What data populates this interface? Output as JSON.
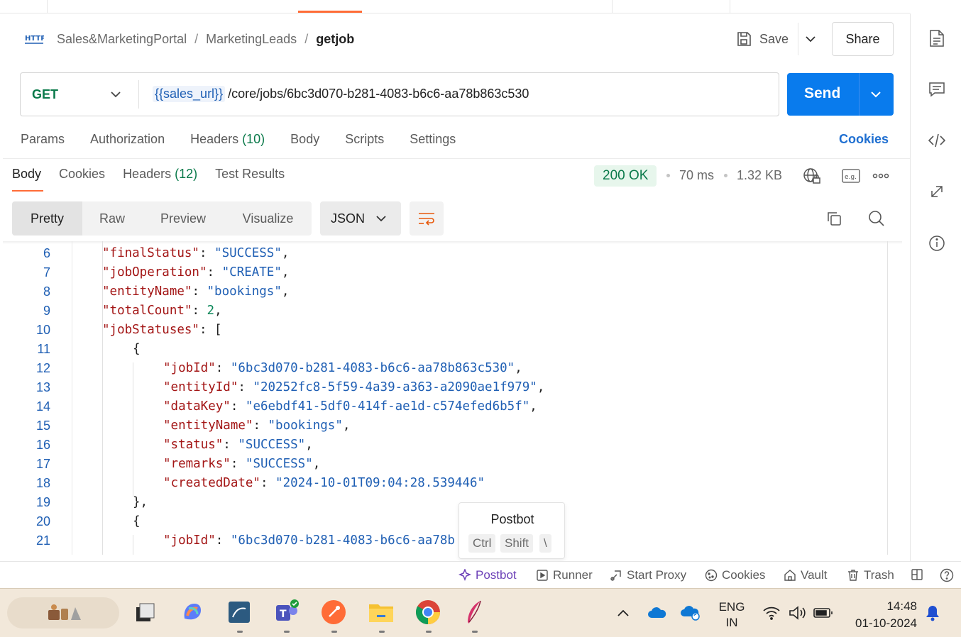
{
  "breadcrumb": {
    "items": [
      "Sales&MarketingPortal",
      "MarketingLeads"
    ],
    "separator": "/",
    "current": "getjob"
  },
  "header": {
    "save_label": "Save",
    "share_label": "Share"
  },
  "request": {
    "method": "GET",
    "url_variable": "{{sales_url}}",
    "url_path": "/core/jobs/6bc3d070-b281-4083-b6c6-aa78b863c530",
    "send_label": "Send"
  },
  "request_tabs": {
    "params": "Params",
    "authorization": "Authorization",
    "headers": "Headers",
    "headers_count": "(10)",
    "body": "Body",
    "scripts": "Scripts",
    "settings": "Settings",
    "cookies": "Cookies"
  },
  "response_tabs": {
    "body": "Body",
    "cookies": "Cookies",
    "headers": "Headers",
    "headers_count": "(12)",
    "test_results": "Test Results"
  },
  "response_meta": {
    "status": "200 OK",
    "time": "70 ms",
    "size": "1.32 KB"
  },
  "view_tabs": [
    "Pretty",
    "Raw",
    "Preview",
    "Visualize"
  ],
  "format": "JSON",
  "code_lines": [
    {
      "n": "6",
      "indent": 1,
      "parts": [
        [
          "k",
          "\"finalStatus\""
        ],
        [
          "p",
          ": "
        ],
        [
          "s",
          "\"SUCCESS\""
        ],
        [
          "p",
          ","
        ]
      ]
    },
    {
      "n": "7",
      "indent": 1,
      "parts": [
        [
          "k",
          "\"jobOperation\""
        ],
        [
          "p",
          ": "
        ],
        [
          "s",
          "\"CREATE\""
        ],
        [
          "p",
          ","
        ]
      ]
    },
    {
      "n": "8",
      "indent": 1,
      "parts": [
        [
          "k",
          "\"entityName\""
        ],
        [
          "p",
          ": "
        ],
        [
          "s",
          "\"bookings\""
        ],
        [
          "p",
          ","
        ]
      ]
    },
    {
      "n": "9",
      "indent": 1,
      "parts": [
        [
          "k",
          "\"totalCount\""
        ],
        [
          "p",
          ": "
        ],
        [
          "n",
          "2"
        ],
        [
          "p",
          ","
        ]
      ]
    },
    {
      "n": "10",
      "indent": 1,
      "parts": [
        [
          "k",
          "\"jobStatuses\""
        ],
        [
          "p",
          ": ["
        ]
      ]
    },
    {
      "n": "11",
      "indent": 2,
      "parts": [
        [
          "p",
          "{"
        ]
      ]
    },
    {
      "n": "12",
      "indent": 3,
      "parts": [
        [
          "k",
          "\"jobId\""
        ],
        [
          "p",
          ": "
        ],
        [
          "s",
          "\"6bc3d070-b281-4083-b6c6-aa78b863c530\""
        ],
        [
          "p",
          ","
        ]
      ]
    },
    {
      "n": "13",
      "indent": 3,
      "parts": [
        [
          "k",
          "\"entityId\""
        ],
        [
          "p",
          ": "
        ],
        [
          "s",
          "\"20252fc8-5f59-4a39-a363-a2090ae1f979\""
        ],
        [
          "p",
          ","
        ]
      ]
    },
    {
      "n": "14",
      "indent": 3,
      "parts": [
        [
          "k",
          "\"dataKey\""
        ],
        [
          "p",
          ": "
        ],
        [
          "s",
          "\"e6ebdf41-5df0-414f-ae1d-c574efed6b5f\""
        ],
        [
          "p",
          ","
        ]
      ]
    },
    {
      "n": "15",
      "indent": 3,
      "parts": [
        [
          "k",
          "\"entityName\""
        ],
        [
          "p",
          ": "
        ],
        [
          "s",
          "\"bookings\""
        ],
        [
          "p",
          ","
        ]
      ]
    },
    {
      "n": "16",
      "indent": 3,
      "parts": [
        [
          "k",
          "\"status\""
        ],
        [
          "p",
          ": "
        ],
        [
          "s",
          "\"SUCCESS\""
        ],
        [
          "p",
          ","
        ]
      ]
    },
    {
      "n": "17",
      "indent": 3,
      "parts": [
        [
          "k",
          "\"remarks\""
        ],
        [
          "p",
          ": "
        ],
        [
          "s",
          "\"SUCCESS\""
        ],
        [
          "p",
          ","
        ]
      ]
    },
    {
      "n": "18",
      "indent": 3,
      "parts": [
        [
          "k",
          "\"createdDate\""
        ],
        [
          "p",
          ": "
        ],
        [
          "s",
          "\"2024-10-01T09:04:28.539446\""
        ]
      ]
    },
    {
      "n": "19",
      "indent": 2,
      "parts": [
        [
          "p",
          "},"
        ]
      ]
    },
    {
      "n": "20",
      "indent": 2,
      "parts": [
        [
          "p",
          "{"
        ]
      ]
    },
    {
      "n": "21",
      "indent": 3,
      "parts": [
        [
          "k",
          "\"jobId\""
        ],
        [
          "p",
          ": "
        ],
        [
          "s",
          "\"6bc3d070-b281-4083-b6c6-aa78b"
        ]
      ]
    }
  ],
  "tooltip": {
    "title": "Postbot",
    "keys": [
      "Ctrl",
      "Shift",
      "\\"
    ]
  },
  "statusbar": {
    "postbot": "Postbot",
    "runner": "Runner",
    "start_proxy": "Start Proxy",
    "cookies": "Cookies",
    "vault": "Vault",
    "trash": "Trash"
  },
  "taskbar": {
    "language": "ENG",
    "region": "IN",
    "time": "14:48",
    "date": "01-10-2024"
  },
  "colors": {
    "accent_orange": "#ff6c37",
    "send_blue": "#097bed",
    "status_green": "#0b7a4b",
    "json_key": "#a31515",
    "json_string": "#1f5fb4"
  }
}
